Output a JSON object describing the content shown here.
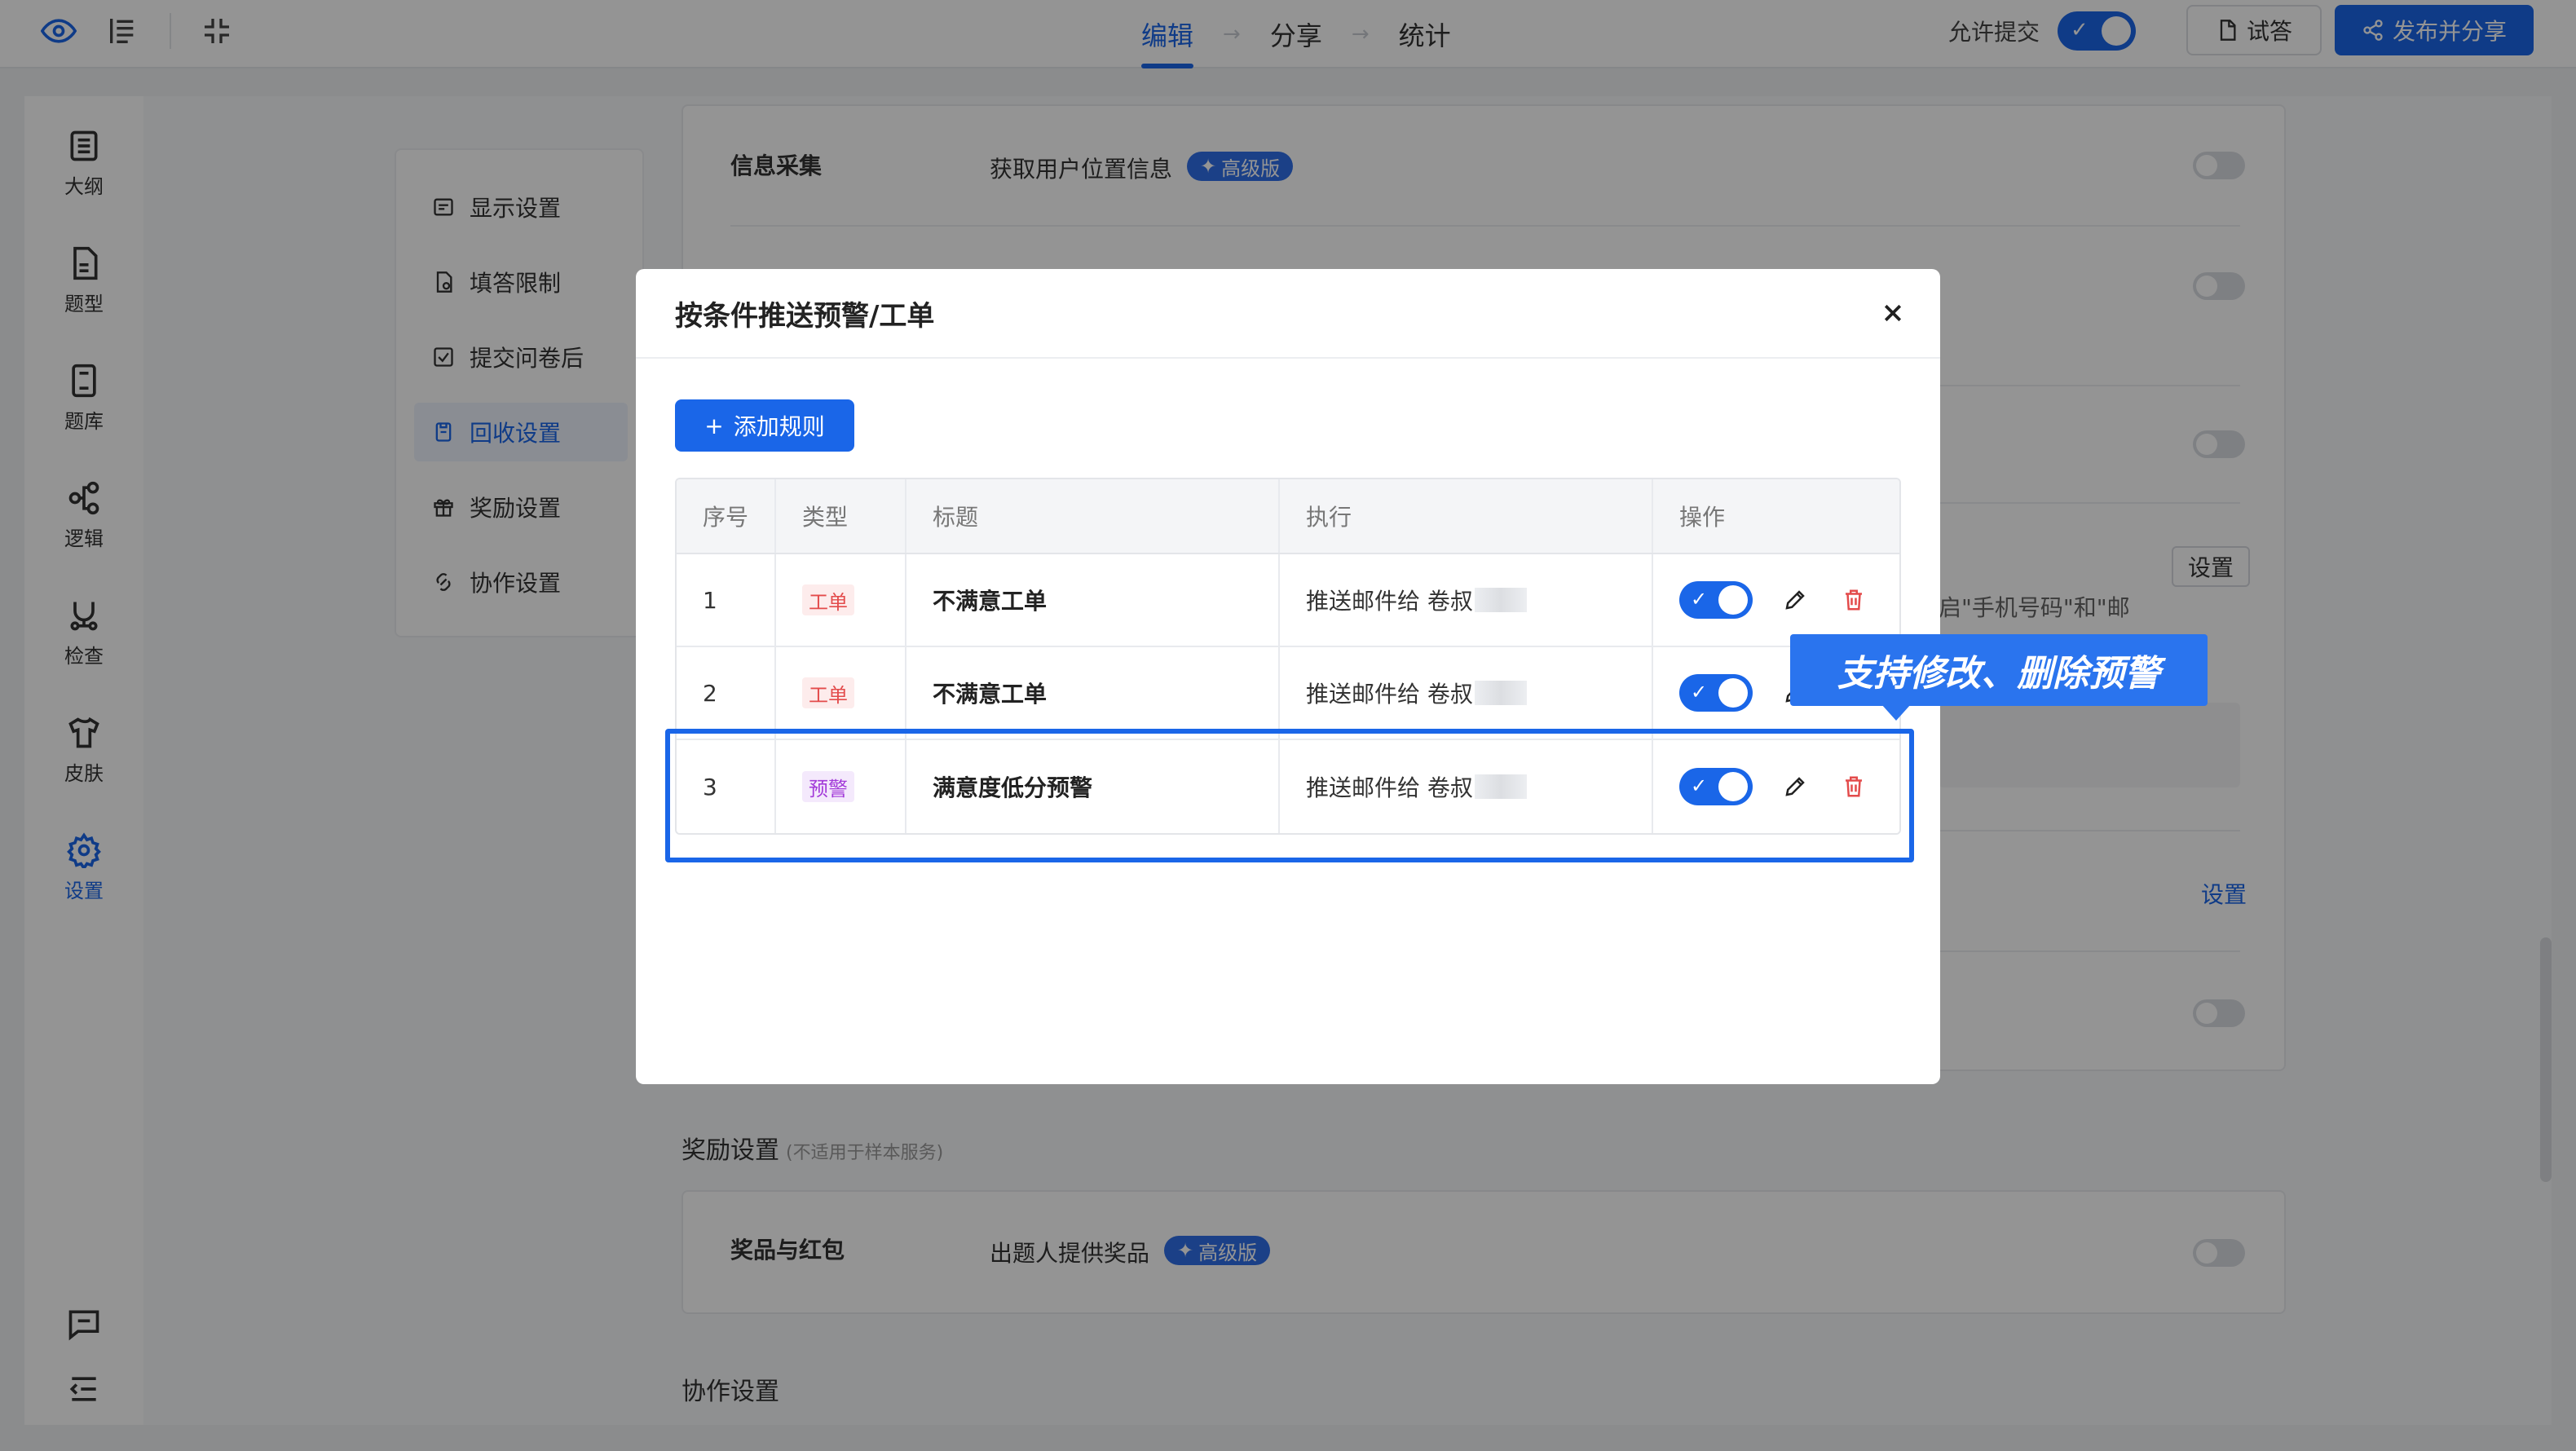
{
  "header": {
    "steps": [
      {
        "label": "编辑"
      },
      {
        "label": "分享"
      },
      {
        "label": "统计"
      }
    ],
    "allow_submit_label": "允许提交",
    "try_button": "试答",
    "publish_button": "发布并分享"
  },
  "rail": {
    "items": [
      {
        "label": "大纲",
        "icon": "outline-icon"
      },
      {
        "label": "题型",
        "icon": "question-type-icon"
      },
      {
        "label": "题库",
        "icon": "question-bank-icon"
      },
      {
        "label": "逻辑",
        "icon": "logic-icon"
      },
      {
        "label": "检查",
        "icon": "check-icon"
      },
      {
        "label": "皮肤",
        "icon": "skin-icon"
      },
      {
        "label": "设置",
        "icon": "settings-icon"
      }
    ]
  },
  "submenu": {
    "items": [
      {
        "label": "显示设置"
      },
      {
        "label": "填答限制"
      },
      {
        "label": "提交问卷后"
      },
      {
        "label": "回收设置"
      },
      {
        "label": "奖励设置"
      },
      {
        "label": "协作设置"
      }
    ]
  },
  "background": {
    "info_collect_label": "信息采集",
    "location_label": "获取用户位置信息",
    "pro_badge": "高级版",
    "setting_button": "设置",
    "phone_hint": "启\"手机号码\"和\"邮",
    "setting_link": "设置",
    "reward_section": "奖励设置",
    "reward_note": "(不适用于样本服务)",
    "prize_label": "奖品与红包",
    "prize_desc": "出题人提供奖品",
    "collab_section": "协作设置"
  },
  "modal": {
    "title": "按条件推送预警/工单",
    "add_rule_button": "添加规则",
    "columns": [
      "序号",
      "类型",
      "标题",
      "执行",
      "操作"
    ],
    "rows": [
      {
        "index": "1",
        "type": "工单",
        "title": "不满意工单",
        "action": "推送邮件给 卷叔"
      },
      {
        "index": "2",
        "type": "工单",
        "title": "不满意工单",
        "action": "推送邮件给 卷叔"
      },
      {
        "index": "3",
        "type": "预警",
        "title": "满意度低分预警",
        "action": "推送邮件给 卷叔"
      }
    ]
  },
  "callout": "支持修改、删除预警",
  "colors": {
    "accent": "#1a66e8",
    "tag_order": "#e34b4b",
    "tag_warn": "#a33bd9",
    "delete": "#e34b4b"
  }
}
